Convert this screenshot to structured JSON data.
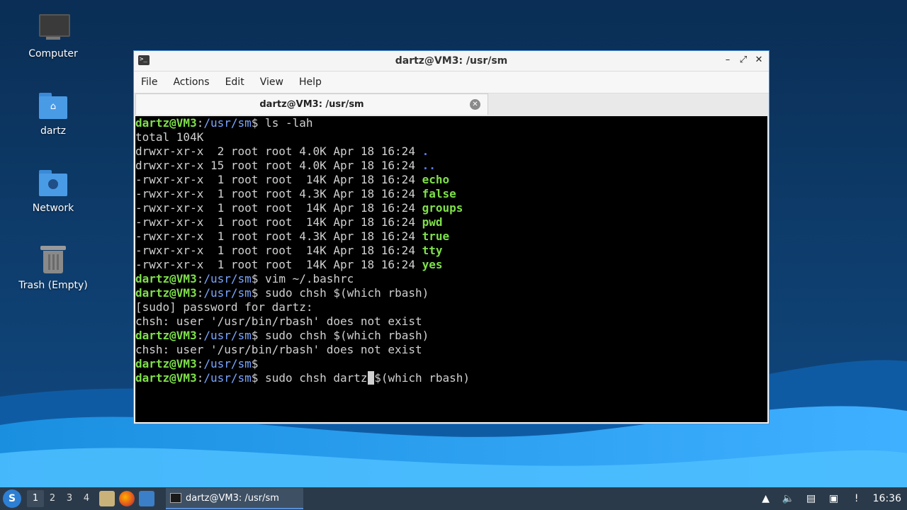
{
  "desktop": {
    "icons": [
      {
        "label": "Computer",
        "icon": "computer-icon"
      },
      {
        "label": "dartz",
        "icon": "home-folder-icon"
      },
      {
        "label": "Network",
        "icon": "network-folder-icon"
      },
      {
        "label": "Trash (Empty)",
        "icon": "trash-icon"
      }
    ]
  },
  "window": {
    "title": "dartz@VM3: /usr/sm",
    "app_icon_glyph": ">_",
    "controls": {
      "minimize": "–",
      "maximize": "⤢",
      "close": "✕"
    },
    "menu": [
      "File",
      "Actions",
      "Edit",
      "View",
      "Help"
    ],
    "tab": {
      "label": "dartz@VM3: /usr/sm",
      "close": "✕"
    }
  },
  "terminal": {
    "user_host": "dartz@VM3",
    "path": "/usr/sm",
    "lines": [
      {
        "type": "prompt",
        "cmd": " ls -lah"
      },
      {
        "type": "text",
        "text": "total 104K"
      },
      {
        "type": "ls",
        "perms": "drwxr-xr-x  2 root root 4.0K Apr 18 16:24 ",
        "name": ".",
        "kind": "dir"
      },
      {
        "type": "ls",
        "perms": "drwxr-xr-x 15 root root 4.0K Apr 18 16:24 ",
        "name": "..",
        "kind": "dir"
      },
      {
        "type": "ls",
        "perms": "-rwxr-xr-x  1 root root  14K Apr 18 16:24 ",
        "name": "echo",
        "kind": "exe"
      },
      {
        "type": "ls",
        "perms": "-rwxr-xr-x  1 root root 4.3K Apr 18 16:24 ",
        "name": "false",
        "kind": "exe"
      },
      {
        "type": "ls",
        "perms": "-rwxr-xr-x  1 root root  14K Apr 18 16:24 ",
        "name": "groups",
        "kind": "exe"
      },
      {
        "type": "ls",
        "perms": "-rwxr-xr-x  1 root root  14K Apr 18 16:24 ",
        "name": "pwd",
        "kind": "exe"
      },
      {
        "type": "ls",
        "perms": "-rwxr-xr-x  1 root root 4.3K Apr 18 16:24 ",
        "name": "true",
        "kind": "exe"
      },
      {
        "type": "ls",
        "perms": "-rwxr-xr-x  1 root root  14K Apr 18 16:24 ",
        "name": "tty",
        "kind": "exe"
      },
      {
        "type": "ls",
        "perms": "-rwxr-xr-x  1 root root  14K Apr 18 16:24 ",
        "name": "yes",
        "kind": "exe"
      },
      {
        "type": "prompt",
        "cmd": " vim ~/.bashrc"
      },
      {
        "type": "prompt",
        "cmd": " sudo chsh $(which rbash)"
      },
      {
        "type": "text",
        "text": "[sudo] password for dartz:"
      },
      {
        "type": "text",
        "text": "chsh: user '/usr/bin/rbash' does not exist"
      },
      {
        "type": "prompt",
        "cmd": " sudo chsh $(which rbash)"
      },
      {
        "type": "text",
        "text": "chsh: user '/usr/bin/rbash' does not exist"
      },
      {
        "type": "prompt",
        "cmd": ""
      },
      {
        "type": "prompt_cursor",
        "before": " sudo chsh dartz",
        "cursor": " ",
        "after": "$(which rbash)"
      }
    ]
  },
  "taskbar": {
    "start_glyph": "S",
    "workspaces": [
      "1",
      "2",
      "3",
      "4"
    ],
    "active_workspace": "1",
    "quick_launch": [
      "file-manager-icon",
      "firefox-icon",
      "show-desktop-icon"
    ],
    "window_button": "dartz@VM3: /usr/sm",
    "tray": [
      "updates-icon",
      "volume-icon",
      "clipboard-icon",
      "network-icon",
      "notification-icon"
    ],
    "clock": "16:36"
  }
}
